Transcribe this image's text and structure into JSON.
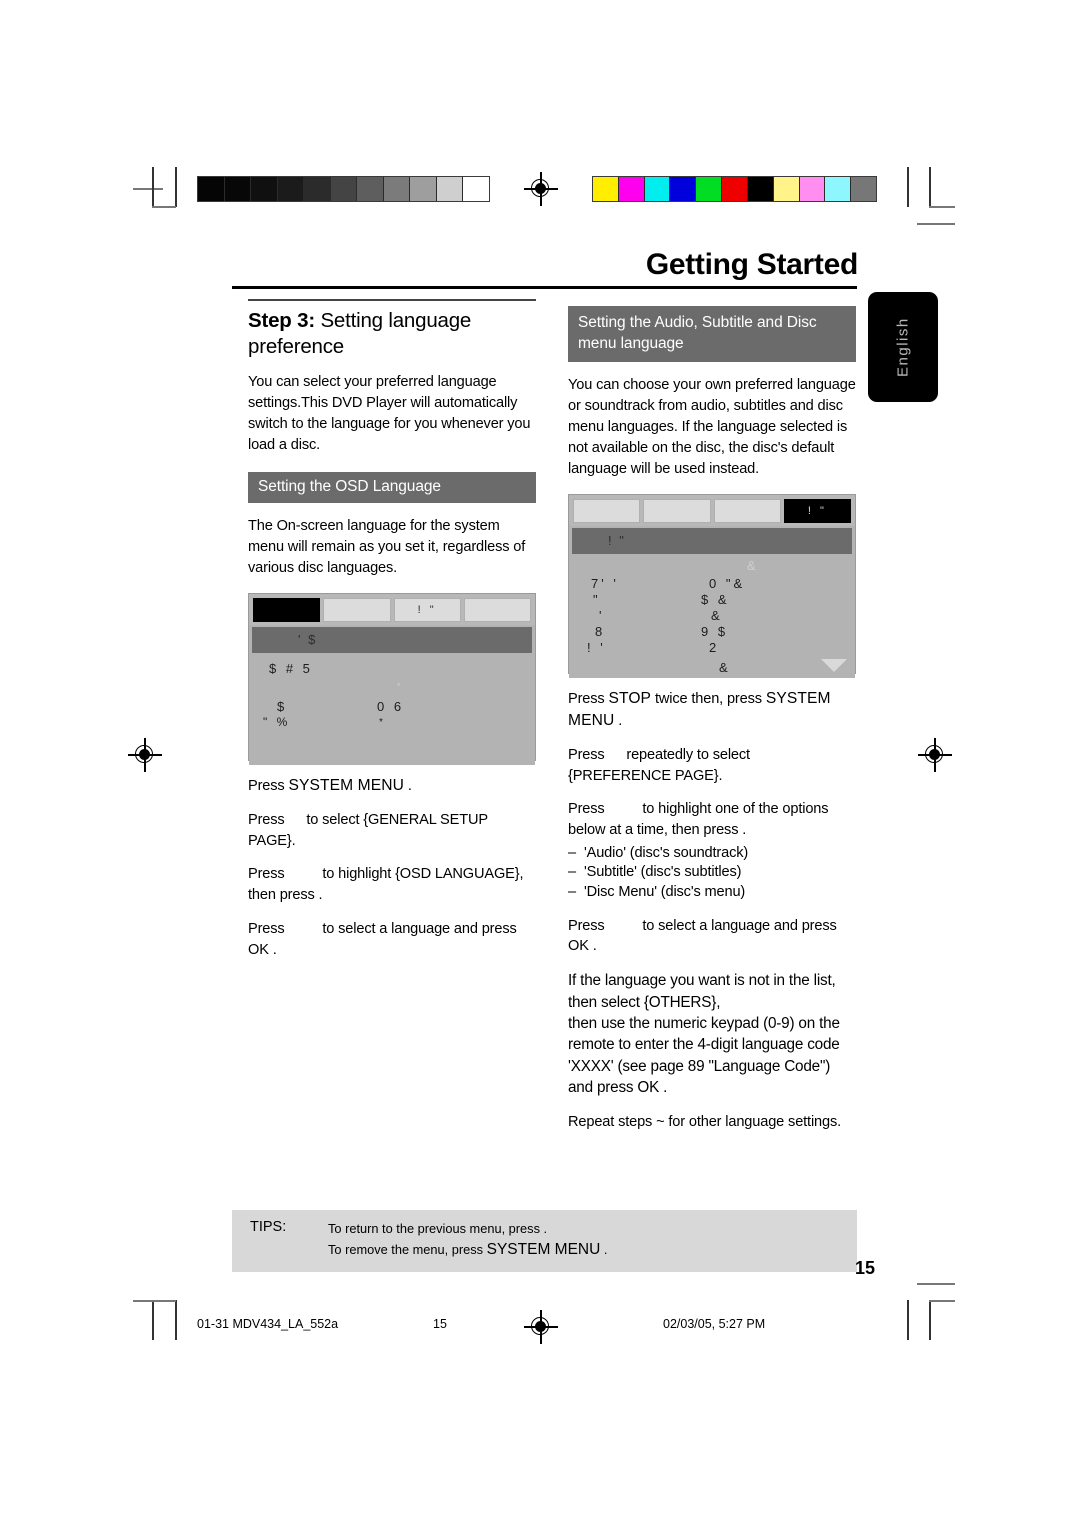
{
  "header": {
    "chapter_title": "Getting Started",
    "language_tab": "English"
  },
  "left_column": {
    "step_label": "Step 3:",
    "step_title": " Setting language preference",
    "intro": "You can select your preferred language settings.This DVD Player will automatically switch to the language for you whenever you load a disc.",
    "section_band": "Setting the OSD Language",
    "section_intro": "The On-screen language for the system menu will remain as you set it, regardless of various disc languages.",
    "osd": {
      "tabs": [
        "",
        "",
        "!  \"",
        ""
      ],
      "selected_tab_index": 0,
      "title_glyph": "' $",
      "rows": [
        "$ #  5",
        "*",
        "$",
        "0  6",
        "\"    %",
        "*"
      ]
    },
    "steps": [
      {
        "pre": "Press ",
        "kbd": "SYSTEM MENU",
        "post": " ."
      },
      {
        "pre": "Press ",
        "gap": true,
        "post": " to select {GENERAL SETUP PAGE}."
      },
      {
        "pre": "Press ",
        "gap": true,
        "post": " to highlight {OSD LANGUAGE}, then press  ."
      },
      {
        "pre": "Press ",
        "gap": true,
        "post": " to select a language and press OK ."
      }
    ]
  },
  "right_column": {
    "section_band": "Setting the Audio, Subtitle and Disc menu language",
    "intro": "You can choose your own preferred language or soundtrack from audio, subtitles and disc menu languages. If the language selected is not available on the disc, the disc's default language will be used instead.",
    "osd": {
      "tabs": [
        "",
        "",
        "",
        "!   \""
      ],
      "selected_tab_index": 3,
      "title_glyph": "!   \"",
      "rows_left": [
        "7' '",
        "\"",
        "'",
        "8",
        "!  '"
      ],
      "rows_right": [
        "0  \"&",
        "$   &",
        "&",
        "9 $",
        "2"
      ],
      "top_faint": "&",
      "bottom_glyph": "&",
      "scroll_arrow": "down-arrow"
    },
    "steps": [
      {
        "pre": "Press ",
        "kbd": "STOP",
        "mid": " twice then, press ",
        "kbd2": "SYSTEM MENU",
        "post": " ."
      },
      {
        "pre": "Press ",
        "gap": true,
        "post": " repeatedly to select {PREFERENCE PAGE}."
      },
      {
        "pre": "Press ",
        "gap": true,
        "post": " to highlight one of the options below at a time, then press  ."
      },
      {
        "pre": "Press ",
        "gap": true,
        "post": " to select a language and press OK ."
      }
    ],
    "options": [
      "'Audio' (disc's soundtrack)",
      "'Subtitle' (disc's subtitles)",
      "'Disc Menu' (disc's menu)"
    ],
    "others_note_line1": "If the language you want is not in the list, then select  {OTHERS},",
    "others_note_line2": "then use the numeric keypad (0-9)  on the remote to enter the 4-digit language code 'XXXX' (see page 89 \"Language Code\") and press OK .",
    "repeat_note": "Repeat steps   ~    for other language settings."
  },
  "tips": {
    "label": "TIPS:",
    "line1": "To return to the previous menu, press  .",
    "line2_pre": "To remove the menu, press ",
    "line2_kbd": "SYSTEM MENU",
    "line2_post": " ."
  },
  "page_number": "15",
  "plate_footer": {
    "filename": "01-31 MDV434_LA_552a",
    "page": "15",
    "date": "02/03/05, 5:27 PM"
  },
  "print_marks": {
    "grayscale_swatches": [
      "#050505",
      "#070707",
      "#101010",
      "#1b1b1b",
      "#2b2b2b",
      "#444444",
      "#5e5e5e",
      "#7b7b7b",
      "#9e9e9e",
      "#cfcfcf",
      "#ffffff"
    ],
    "color_swatches": [
      "#ffee00",
      "#ff00ee",
      "#00eeee",
      "#0000dd",
      "#00dd22",
      "#ee0000",
      "#000000",
      "#fff389",
      "#ff8ef0",
      "#8ef6ff",
      "#777777"
    ]
  }
}
